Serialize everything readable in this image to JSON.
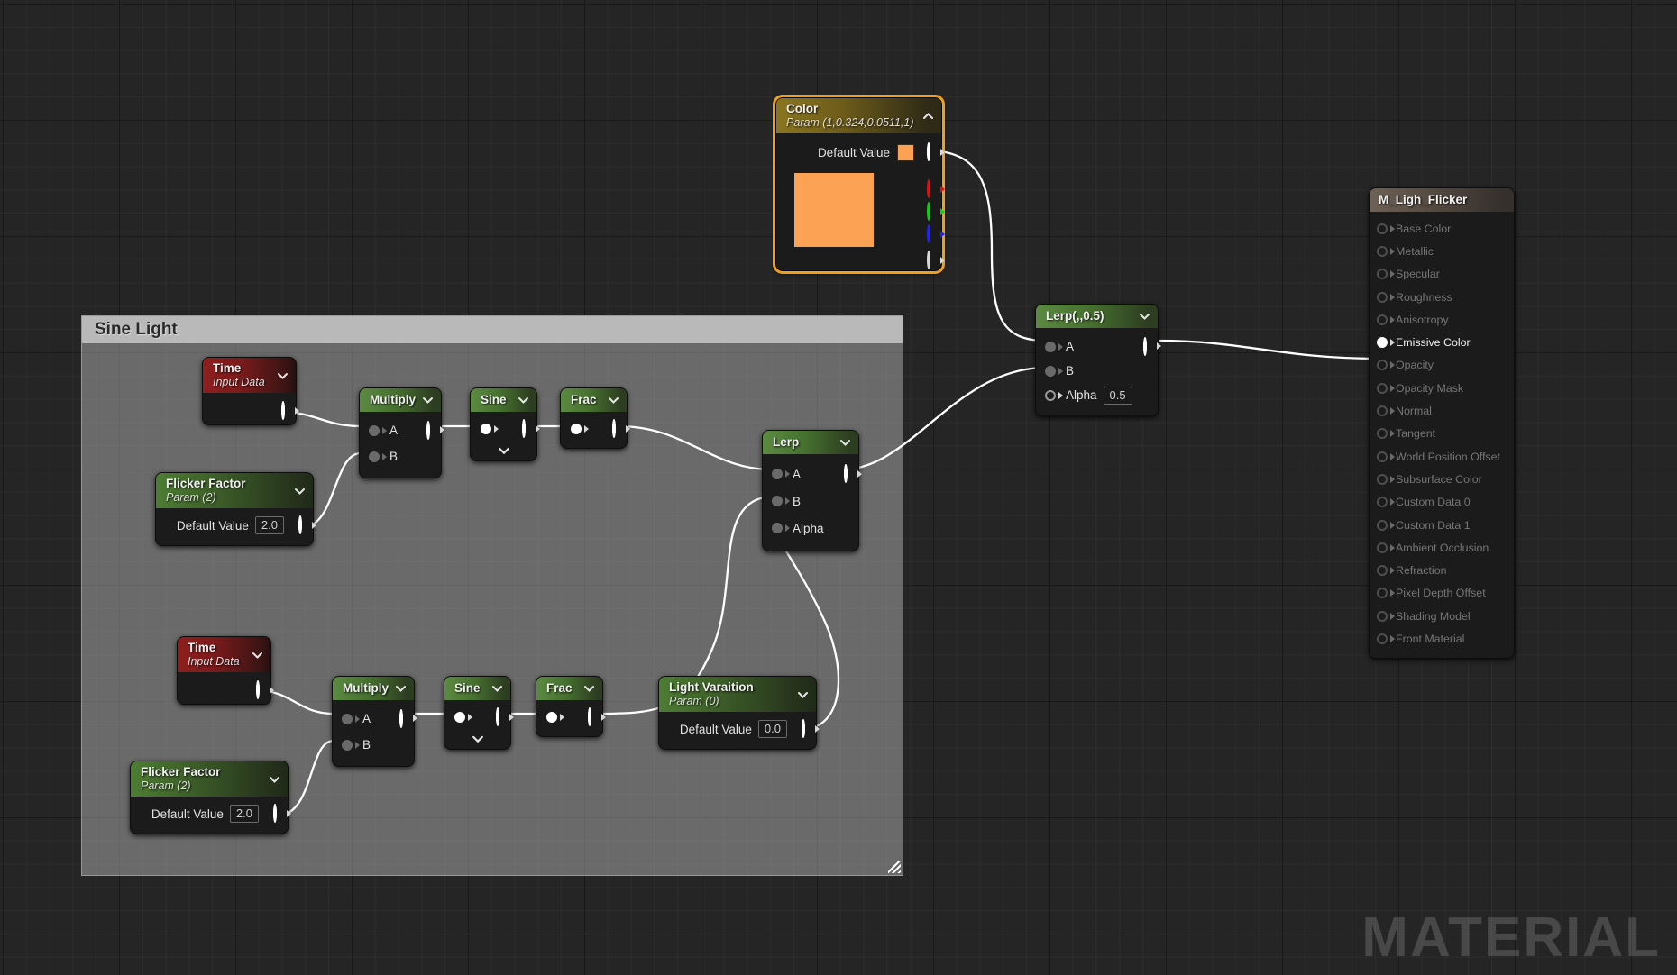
{
  "app": {
    "watermark": "MATERIAL"
  },
  "comment": {
    "title": "Sine Light"
  },
  "nodes": {
    "color_param": {
      "title": "Color",
      "subtitle": "Param (1,0.324,0.0511,1)",
      "default_value_label": "Default Value",
      "swatch_color": "#fba254",
      "outputs": [
        "RGBA",
        "R",
        "G",
        "B",
        "A"
      ]
    },
    "lerp_main": {
      "title": "Lerp(,,0.5)",
      "inputs": [
        "A",
        "B",
        "Alpha"
      ],
      "alpha_value": "0.5"
    },
    "lerp_mid": {
      "title": "Lerp",
      "inputs": [
        "A",
        "B",
        "Alpha"
      ]
    },
    "time_top": {
      "title": "Time",
      "subtitle": "Input Data"
    },
    "time_bottom": {
      "title": "Time",
      "subtitle": "Input Data"
    },
    "flicker_top": {
      "title": "Flicker Factor",
      "subtitle": "Param (2)",
      "default_value_label": "Default Value",
      "default_value": "2.0"
    },
    "flicker_bottom": {
      "title": "Flicker Factor",
      "subtitle": "Param (2)",
      "default_value_label": "Default Value",
      "default_value": "2.0"
    },
    "light_variation": {
      "title": "Light Varaition",
      "subtitle": "Param (0)",
      "default_value_label": "Default Value",
      "default_value": "0.0"
    },
    "multiply_top": {
      "title": "Multiply",
      "inputs": [
        "A",
        "B"
      ]
    },
    "multiply_bottom": {
      "title": "Multiply",
      "inputs": [
        "A",
        "B"
      ]
    },
    "sine_top": {
      "title": "Sine"
    },
    "sine_bottom": {
      "title": "Sine"
    },
    "frac_top": {
      "title": "Frac"
    },
    "frac_bottom": {
      "title": "Frac"
    }
  },
  "material_output": {
    "title": "M_Ligh_Flicker",
    "pins": [
      {
        "label": "Base Color",
        "connected": false
      },
      {
        "label": "Metallic",
        "connected": false
      },
      {
        "label": "Specular",
        "connected": false
      },
      {
        "label": "Roughness",
        "connected": false
      },
      {
        "label": "Anisotropy",
        "connected": false
      },
      {
        "label": "Emissive Color",
        "connected": true
      },
      {
        "label": "Opacity",
        "connected": false
      },
      {
        "label": "Opacity Mask",
        "connected": false
      },
      {
        "label": "Normal",
        "connected": false
      },
      {
        "label": "Tangent",
        "connected": false
      },
      {
        "label": "World Position Offset",
        "connected": false
      },
      {
        "label": "Subsurface Color",
        "connected": false
      },
      {
        "label": "Custom Data 0",
        "connected": false
      },
      {
        "label": "Custom Data 1",
        "connected": false
      },
      {
        "label": "Ambient Occlusion",
        "connected": false
      },
      {
        "label": "Refraction",
        "connected": false
      },
      {
        "label": "Pixel Depth Offset",
        "connected": false
      },
      {
        "label": "Shading Model",
        "connected": false
      },
      {
        "label": "Front Material",
        "connected": false
      }
    ]
  },
  "colors": {
    "background": "#252525",
    "node_body": "#1b1b1b",
    "accent_selected": "#f0a020",
    "wire": "#ffffff",
    "param_green": "#4d7d33",
    "time_red": "#8f1f1f"
  }
}
